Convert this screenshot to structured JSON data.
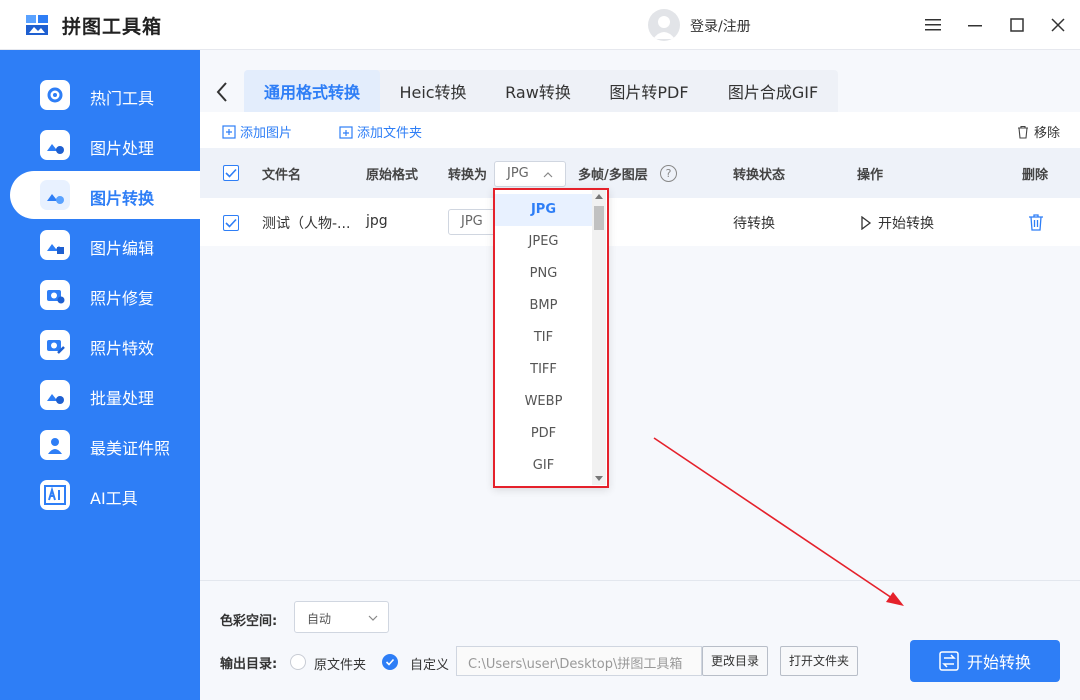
{
  "app": {
    "title": "拼图工具箱",
    "login_label": "登录/注册"
  },
  "sidebar": {
    "items": [
      {
        "label": "热门工具",
        "icon": "gear-tools-icon"
      },
      {
        "label": "图片处理",
        "icon": "image-clock-icon"
      },
      {
        "label": "图片转换",
        "icon": "image-convert-icon",
        "active": true
      },
      {
        "label": "图片编辑",
        "icon": "image-edit-icon"
      },
      {
        "label": "照片修复",
        "icon": "camera-plus-icon"
      },
      {
        "label": "照片特效",
        "icon": "camera-magic-icon"
      },
      {
        "label": "批量处理",
        "icon": "image-batch-icon"
      },
      {
        "label": "最美证件照",
        "icon": "id-photo-icon"
      },
      {
        "label": "AI工具",
        "icon": "ai-icon"
      }
    ]
  },
  "tabs": [
    {
      "label": "通用格式转换",
      "active": true
    },
    {
      "label": "Heic转换"
    },
    {
      "label": "Raw转换"
    },
    {
      "label": "图片转PDF"
    },
    {
      "label": "图片合成GIF"
    }
  ],
  "toolbar": {
    "add_image": "添加图片",
    "add_folder": "添加文件夹",
    "remove": "移除"
  },
  "table": {
    "headers": {
      "filename": "文件名",
      "original_format": "原始格式",
      "convert_to": "转换为",
      "convert_to_value": "JPG",
      "multi_frame": "多帧/多图层",
      "status": "转换状态",
      "action": "操作",
      "delete": "删除"
    },
    "rows": [
      {
        "filename": "测试（人物-...",
        "original_format": "jpg",
        "target_format": "JPG",
        "status": "待转换",
        "action": "开始转换"
      }
    ]
  },
  "dropdown": {
    "options": [
      "JPG",
      "JPEG",
      "PNG",
      "BMP",
      "TIF",
      "TIFF",
      "WEBP",
      "PDF",
      "GIF"
    ],
    "selected": "JPG"
  },
  "bottom": {
    "color_space_label": "色彩空间:",
    "color_space_value": "自动",
    "output_dir_label": "输出目录:",
    "option_original": "原文件夹",
    "option_custom": "自定义",
    "path_value": "C:\\Users\\user\\Desktop\\拼图工具箱",
    "change_dir": "更改目录",
    "open_folder": "打开文件夹",
    "start_button": "开始转换"
  },
  "colors": {
    "accent": "#2e7ef6",
    "highlight_box": "#e5212b"
  }
}
